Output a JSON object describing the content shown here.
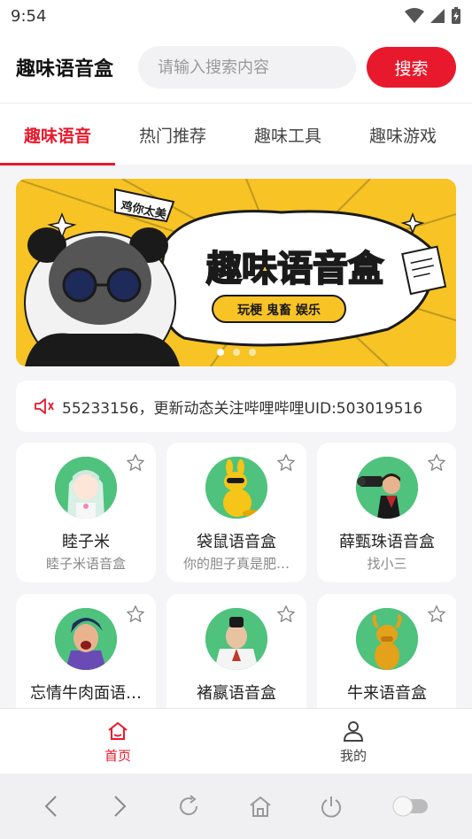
{
  "status": {
    "time": "9:54"
  },
  "header": {
    "title": "趣味语音盒",
    "search_placeholder": "请输入搜索内容",
    "search_button": "搜索"
  },
  "tabs": [
    {
      "label": "趣味语音",
      "active": true
    },
    {
      "label": "热门推荐",
      "active": false
    },
    {
      "label": "趣味工具",
      "active": false
    },
    {
      "label": "趣味游戏",
      "active": false
    }
  ],
  "banner": {
    "bubble_text": "鸡你太美",
    "title": "趣味语音盒",
    "tagline": "玩梗 鬼畜 娱乐",
    "page_count": 3,
    "current_page": 1
  },
  "notice": {
    "text": "55233156，更新动态关注哔哩哔哩UID:503019516"
  },
  "cards": [
    {
      "name": "睦子米",
      "sub": "睦子米语音盒",
      "avatar": "anime-girl-avatar"
    },
    {
      "name": "袋鼠语音盒",
      "sub": "你的胆子真是肥…",
      "avatar": "kangaroo-avatar"
    },
    {
      "name": "薛甄珠语音盒",
      "sub": "找小三",
      "avatar": "camera-man-avatar"
    },
    {
      "name": "忘情牛肉面语…",
      "sub": "",
      "avatar": "shouting-man-avatar"
    },
    {
      "name": "褚嬴语音盒",
      "sub": "",
      "avatar": "ancient-scholar-avatar"
    },
    {
      "name": "牛来语音盒",
      "sub": "",
      "avatar": "bull-avatar"
    }
  ],
  "bottom_nav": [
    {
      "label": "首页",
      "icon": "home-icon",
      "active": true
    },
    {
      "label": "我的",
      "icon": "user-icon",
      "active": false
    }
  ],
  "colors": {
    "accent": "#e8192c",
    "avatar_bg": "#4fc27d",
    "banner_bg": "#f7c325"
  }
}
